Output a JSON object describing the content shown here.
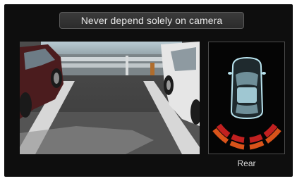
{
  "banner": {
    "text": "Never depend solely on camera"
  },
  "sensor_view": {
    "label": "Rear",
    "car_color": "#b9e4ef",
    "zone_colors": [
      "#c12020",
      "#d9531a",
      "#e58a1e"
    ]
  }
}
